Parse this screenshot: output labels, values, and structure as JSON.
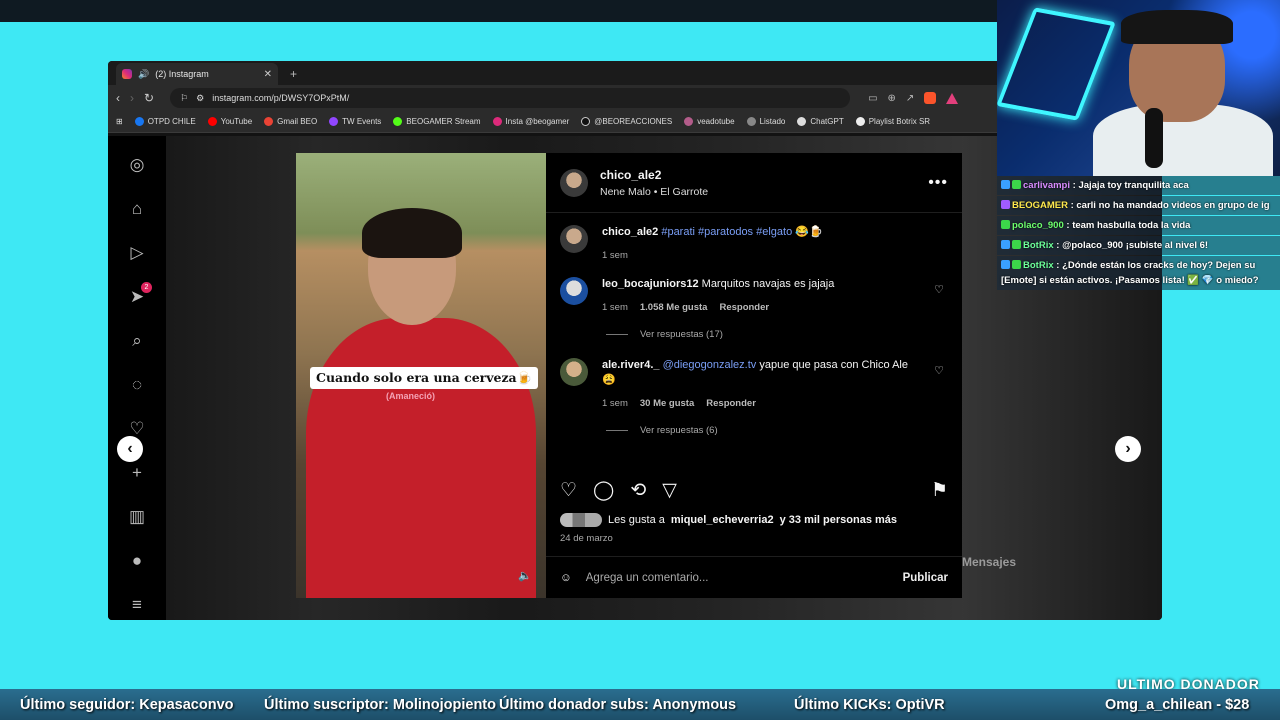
{
  "browser": {
    "tab_title": "(2) Instagram",
    "url": "instagram.com/p/DWSY7OPxPtM/",
    "bookmarks": [
      "OTPD CHILE",
      "YouTube",
      "Gmail BEO",
      "TW Events",
      "BEOGAMER Stream",
      "Insta @beogamer",
      "@BEOREACCIONES",
      "veadotube",
      "Listado",
      "ChatGPT",
      "Playlist Botrix SR"
    ]
  },
  "video": {
    "caption": "Cuando solo era una cerveza🍺",
    "caption_sub": "(Amaneció)"
  },
  "post": {
    "username": "chico_ale2",
    "audio": "Nene Malo • El Garrote",
    "caption_user": "chico_ale2",
    "caption_tags": "#parati #paratodos #elgato 😂🍺",
    "caption_time": "1 sem",
    "comments": [
      {
        "user": "leo_bocajuniors12",
        "text": "Marquitos navajas es jajaja",
        "time": "1 sem",
        "likes": "1.058 Me gusta",
        "reply": "Responder",
        "replies": "Ver respuestas (17)"
      },
      {
        "user": "ale.river4._",
        "mention": "@diegogonzalez.tv",
        "text": "yapue que pasa con Chico Ale 😩",
        "time": "1 sem",
        "likes": "30 Me gusta",
        "reply": "Responder",
        "replies": "Ver respuestas (6)"
      }
    ],
    "likes_prefix": "Les gusta a",
    "likes_user": "miquel_echeverria2",
    "likes_suffix": "y 33 mil personas más",
    "date": "24 de marzo",
    "comment_placeholder": "Agrega un comentario...",
    "publish": "Publicar"
  },
  "messages_label": "Mensajes",
  "chat": [
    {
      "user": "carlivampi",
      "text": ": Jajaja toy tranquilita aca"
    },
    {
      "user": "BEOGAMER",
      "text": ": carli no ha mandado videos en grupo de ig"
    },
    {
      "user": "polaco_900",
      "text": ": team hasbulla toda la vida"
    },
    {
      "user": "BotRix",
      "text": ": @polaco_900 ¡subiste al nivel 6!"
    },
    {
      "user": "BotRix",
      "text": ": ¿Dónde están los cracks de hoy? Dejen su [Emote] si están activos. ¡Pasamos lista! ✅ 💎 o miedo?"
    }
  ],
  "ticker": {
    "seguidor": "Último seguidor: Kepasaconvo",
    "suscriptor": "Último suscriptor: Molinojopiento",
    "donador_subs": "Último donador subs: Anonymous",
    "kicks": "Último KICKs: OptiVR",
    "donor_header": "ULTIMO DONADOR",
    "donor": "Omg_a_chilean - $28"
  }
}
